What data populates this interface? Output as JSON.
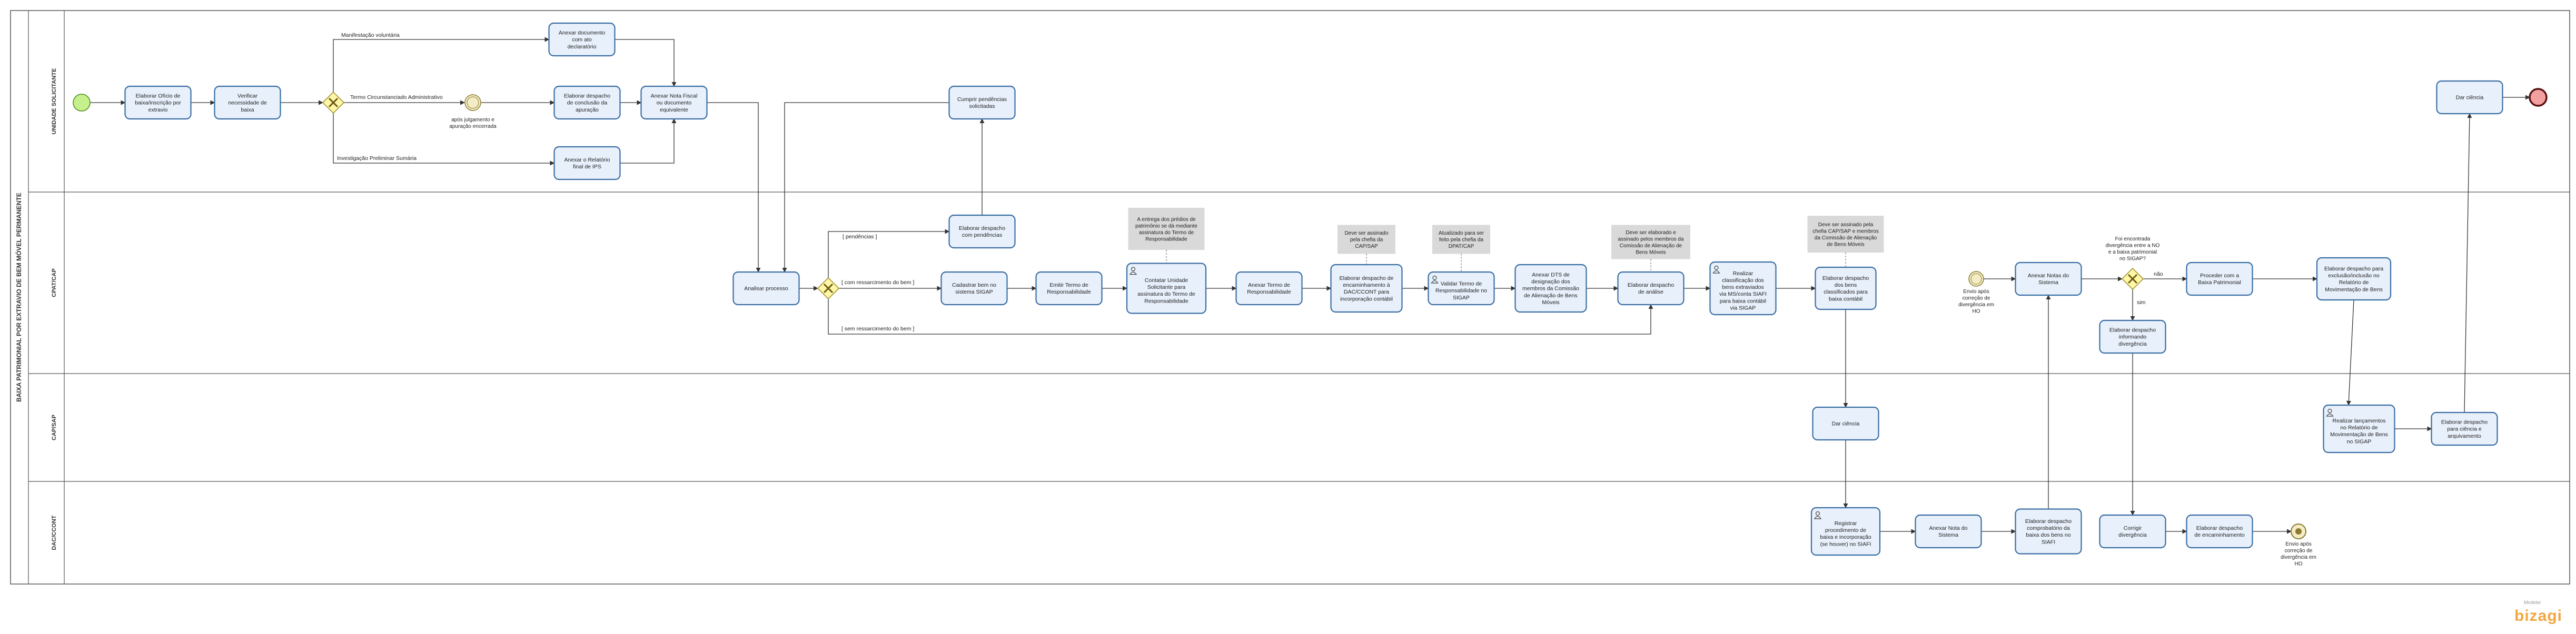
{
  "pool": {
    "label": "BAIXA PATRIMONIAL POR EXTRAVIO DE BEM MÓVEL PERMANENTE"
  },
  "lanes": [
    {
      "id": "ug",
      "label": "UNIDADE SOLICITANTE"
    },
    {
      "id": "cp",
      "label": "CPAT/CAP"
    },
    {
      "id": "ca",
      "label": "CAP/SAP"
    },
    {
      "id": "dc",
      "label": "DAC/CCONT"
    }
  ],
  "tasks": [
    {
      "id": "t1",
      "text": "Elaborar Ofício de baixa/inscrição por extravio"
    },
    {
      "id": "t2",
      "text": "Verificar necessidade de baixa"
    },
    {
      "id": "t3",
      "text": "Anexar documento com ato declaratório"
    },
    {
      "id": "t4",
      "text": "Elaborar despacho de conclusão da apuração"
    },
    {
      "id": "t5",
      "text": "Anexar o Relatório final de IPS"
    },
    {
      "id": "t6",
      "text": "Anexar Nota Fiscal ou documento equivalente"
    },
    {
      "id": "t7",
      "text": "Cumprir pendências solicitadas"
    },
    {
      "id": "t8",
      "text": "Dar ciência"
    },
    {
      "id": "t9",
      "text": "Analisar processo"
    },
    {
      "id": "t10",
      "text": "Elaborar despacho com pendências"
    },
    {
      "id": "t11",
      "text": "Cadastrar bem no sistema SIGAP"
    },
    {
      "id": "t12",
      "text": "Emitir Termo de Responsabilidade"
    },
    {
      "id": "t13",
      "text": "Contatar Unidade Solicitante para assinatura do Termo de Responsabilidade"
    },
    {
      "id": "t14",
      "text": "Anexar Termo de Responsabilidade"
    },
    {
      "id": "t15",
      "text": "Elaborar despacho de encaminhamento à DAC/CCONT para incorporação contábil"
    },
    {
      "id": "t16",
      "text": "Validar Termo de Responsabilidade no SIGAP"
    },
    {
      "id": "t17",
      "text": "Anexar DTS de designação dos membros da Comissão de Alienação de Bens Móveis"
    },
    {
      "id": "t18",
      "text": "Elaborar despacho de análise"
    },
    {
      "id": "t19",
      "text": "Realizar classificação dos bens extraviados via MS/conta SIAFI para baixa contábil via SIGAP"
    },
    {
      "id": "t20",
      "text": "Elaborar despacho dos bens classificados para baixa contábil"
    },
    {
      "id": "t21",
      "text": "Anexar Notas do Sistema"
    },
    {
      "id": "t22",
      "text": "Elaborar despacho informando divergência"
    },
    {
      "id": "t23",
      "text": "Proceder com a Baixa Patrimonial"
    },
    {
      "id": "t24",
      "text": "Elaborar despacho para exclusão/inclusão no Relatório de Movimentação de Bens"
    },
    {
      "id": "t25",
      "text": "Dar ciência"
    },
    {
      "id": "t26",
      "text": "Realizar lançamentos no Relatório de Movimentação de Bens no SIGAP"
    },
    {
      "id": "t27",
      "text": "Elaborar despacho para ciência e arquivamento"
    },
    {
      "id": "t28",
      "text": "Registrar procedimento de baixa e incorporação (se houver) no SIAFI"
    },
    {
      "id": "t29",
      "text": "Anexar Nota do Sistema"
    },
    {
      "id": "t30",
      "text": "Elaborar despacho comprobatório da baixa dos bens no SIAFI"
    },
    {
      "id": "t31",
      "text": "Corrigir divergência"
    },
    {
      "id": "t32",
      "text": "Elaborar despacho de encaminhamento"
    }
  ],
  "annotations": [
    {
      "id": "a1",
      "text": "A entrega dos prédios de patrimônio se dá mediante assinatura do Termo de Responsabilidade"
    },
    {
      "id": "a2",
      "text": "Deve ser assinado pela chefia da CAP/SAP"
    },
    {
      "id": "a3",
      "text": "Atualizado para ser feito pela chefia da DPAT/CAP"
    },
    {
      "id": "a4",
      "text": "Deve ser elaborado e assinado pelos membros da Comissão de Alienação de Bens Móveis"
    },
    {
      "id": "a5",
      "text": "Deve ser assinado pela chefia CAP/SAP e membros da Comissão de Alienação de Bens Móveis"
    }
  ],
  "flow_labels": {
    "manifestacao": "Manifestação voluntária",
    "termo": "Termo Circunstanciado Administrativo",
    "investigacao": "Investigação Preliminar Sumária",
    "pendencias": "[ pendências ]",
    "com_ressarcimento": "[ com ressarcimento do bem ]",
    "sem_ressarcimento": "[ sem ressarcimento do bem ]",
    "nao": "não",
    "sim": "sim"
  },
  "events": {
    "timer1": "após julgamento e apuração encerrada",
    "inter1": "Envio após correção de divergência em HO",
    "end2": "Envio após correção de divergência em HO"
  },
  "gateway_question": "Foi encontrada divergência entre a NO e a baixa patrimonial no SIGAP?",
  "logo": {
    "word": "bizagi",
    "sub": "Modeler"
  },
  "colors": {
    "task_fill": "#e8f0fb",
    "task_stroke": "#3a6ea5",
    "annotation_fill": "#d9d9d9",
    "gateway_fill": "#fff6a8",
    "start_fill": "#c6f08c",
    "end_fill": "#f3a0a0",
    "logo": "#f2a641"
  }
}
